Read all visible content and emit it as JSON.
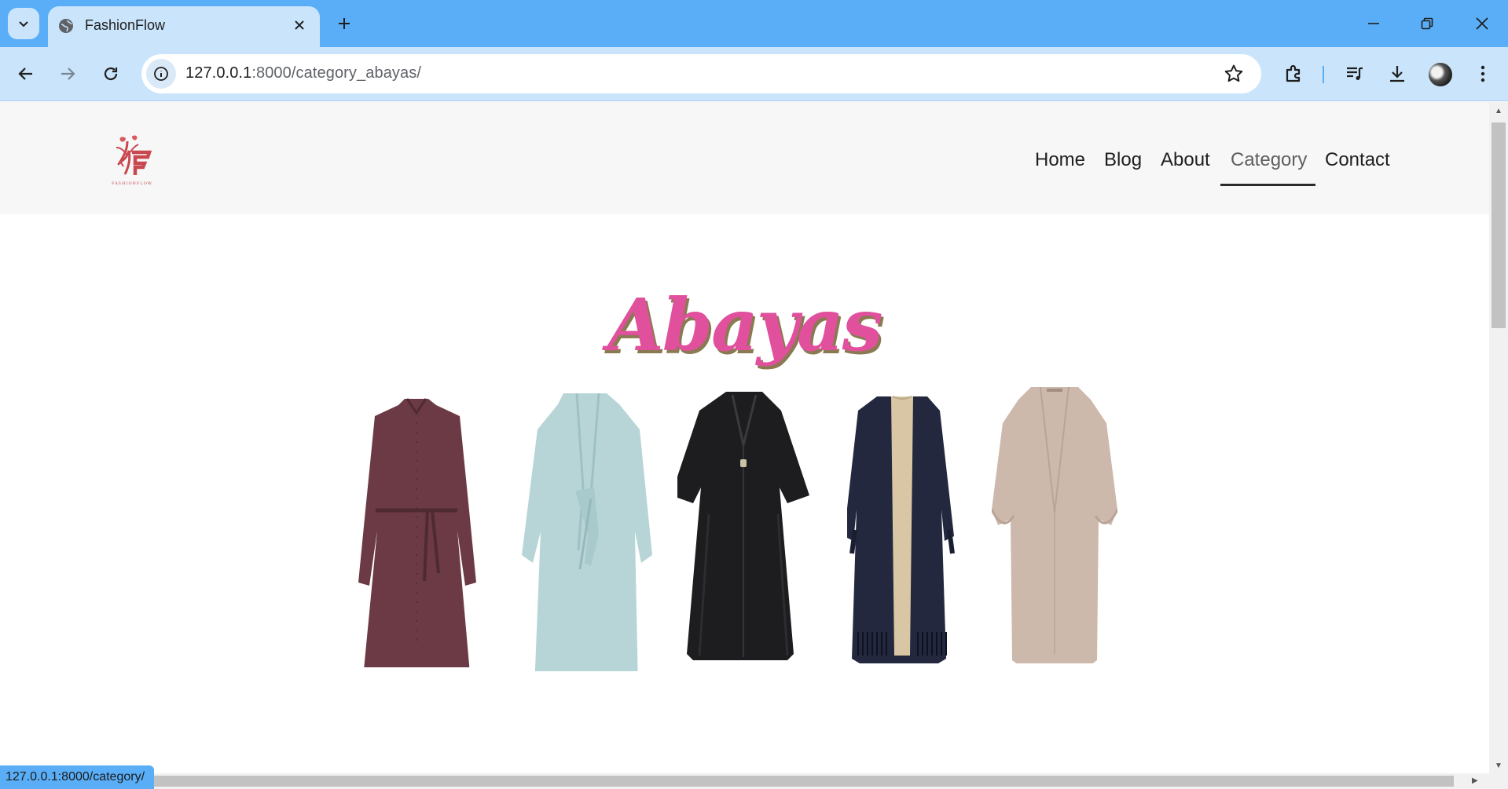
{
  "browser": {
    "tab_title": "FashionFlow",
    "url_host": "127.0.0.1",
    "url_rest": ":8000/category_abayas/",
    "status_url": "127.0.0.1:8000/category/",
    "accent": "#5aaef7"
  },
  "site": {
    "logo_alt": "FASHIONFLOW",
    "nav": [
      {
        "label": "Home"
      },
      {
        "label": "Blog"
      },
      {
        "label": "About"
      },
      {
        "label": "Category",
        "active": true
      },
      {
        "label": "Contact"
      }
    ],
    "heading": "Abayas",
    "heading_color": "#e0509c"
  },
  "products": [
    {
      "name": "burgundy-belted-abaya",
      "color": "#6b3a44"
    },
    {
      "name": "mint-tie-front-abaya",
      "color": "#b7d5d6"
    },
    {
      "name": "black-satin-abaya",
      "color": "#1d1d1f"
    },
    {
      "name": "navy-fringe-abaya",
      "color": "#23283f"
    },
    {
      "name": "beige-balloon-sleeve-abaya",
      "color": "#cdb8ac"
    }
  ]
}
